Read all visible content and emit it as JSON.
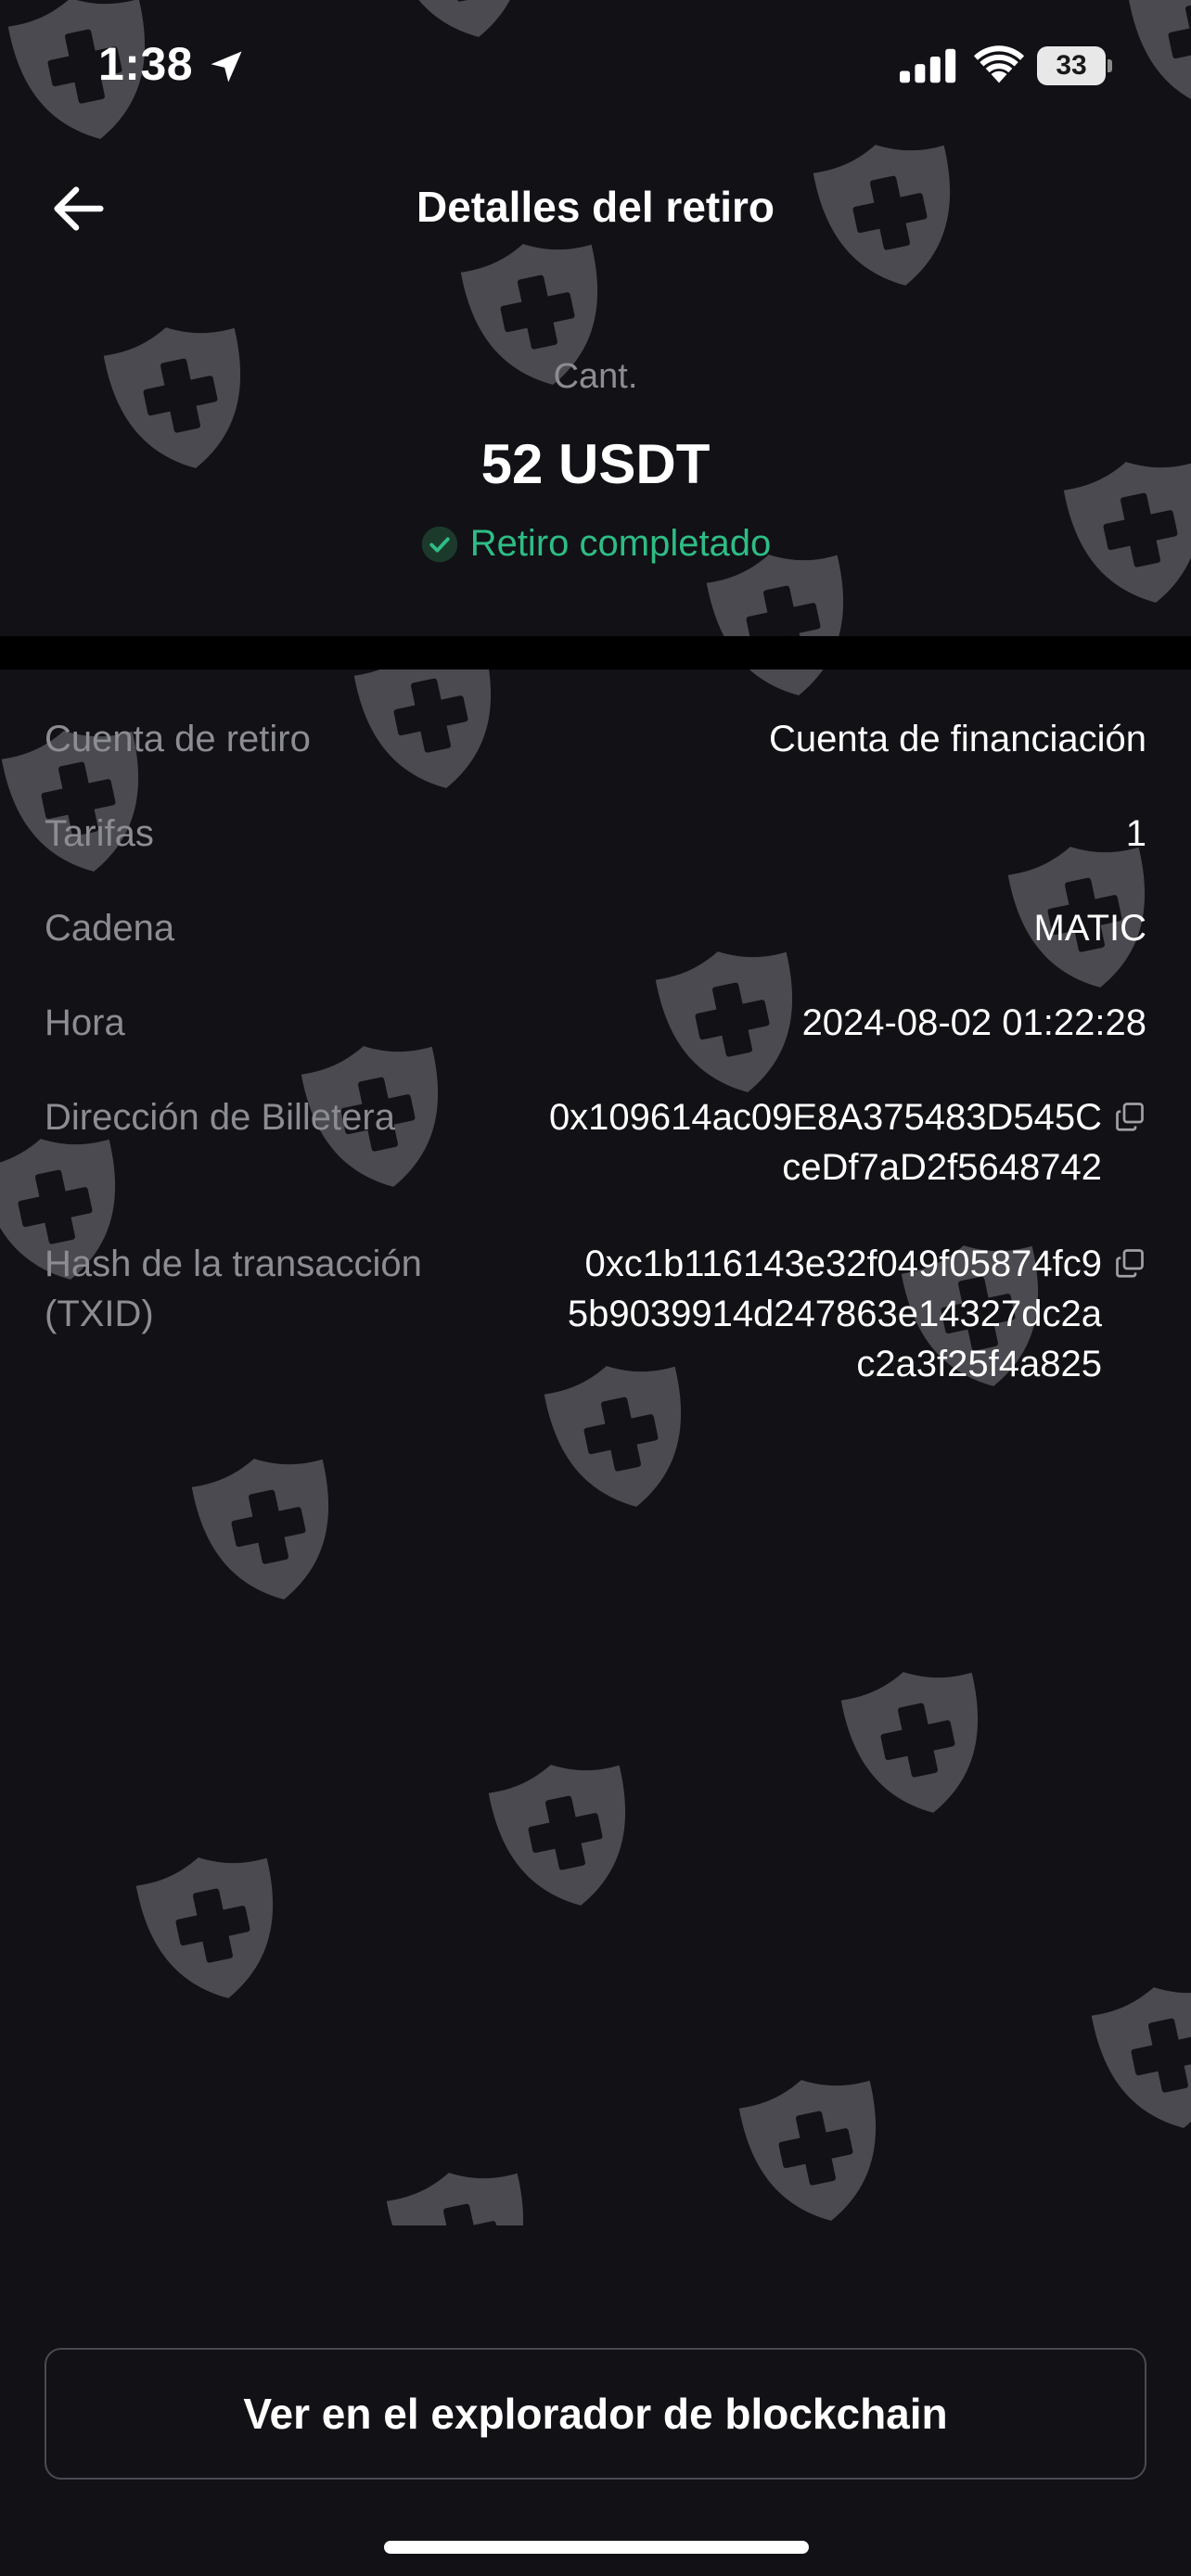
{
  "status_bar": {
    "time": "1:38",
    "battery": "33",
    "icons": [
      "location-arrow-icon",
      "signal-bars-icon",
      "wifi-icon",
      "battery-icon"
    ]
  },
  "header": {
    "back_icon": "arrow-left-icon",
    "title": "Detalles del retiro"
  },
  "summary": {
    "amount_label": "Cant.",
    "amount": "52 USDT",
    "status_icon": "check-circle-icon",
    "status": "Retiro completado"
  },
  "details": {
    "account": {
      "label": "Cuenta de retiro",
      "value": "Cuenta de financiación"
    },
    "fees": {
      "label": "Tarifas",
      "value": "1"
    },
    "chain": {
      "label": "Cadena",
      "value": "MATIC"
    },
    "time": {
      "label": "Hora",
      "value": "2024-08-02 01:22:28"
    },
    "wallet": {
      "label": "Dirección de Billetera",
      "value_lines": [
        "0x109614ac09E8A375483D545C",
        "ceDf7aD2f5648742"
      ],
      "copy_icon": "copy-icon"
    },
    "txid": {
      "label_lines": [
        "Hash de la transacción",
        "(TXID)"
      ],
      "value_lines": [
        "0xc1b116143e32f049f05874fc9",
        "5b9039914d247863e14327dc2a",
        "c2a3f25f4a825"
      ],
      "copy_icon": "copy-icon"
    }
  },
  "footer": {
    "explorer_button": "Ver en el explorador de blockchain"
  },
  "colors": {
    "background": "#111116",
    "accent_green": "#2ebd85",
    "label_gray": "#8c8c93",
    "watermark": "#55555a"
  },
  "watermark_icon": "shield-plus-icon"
}
